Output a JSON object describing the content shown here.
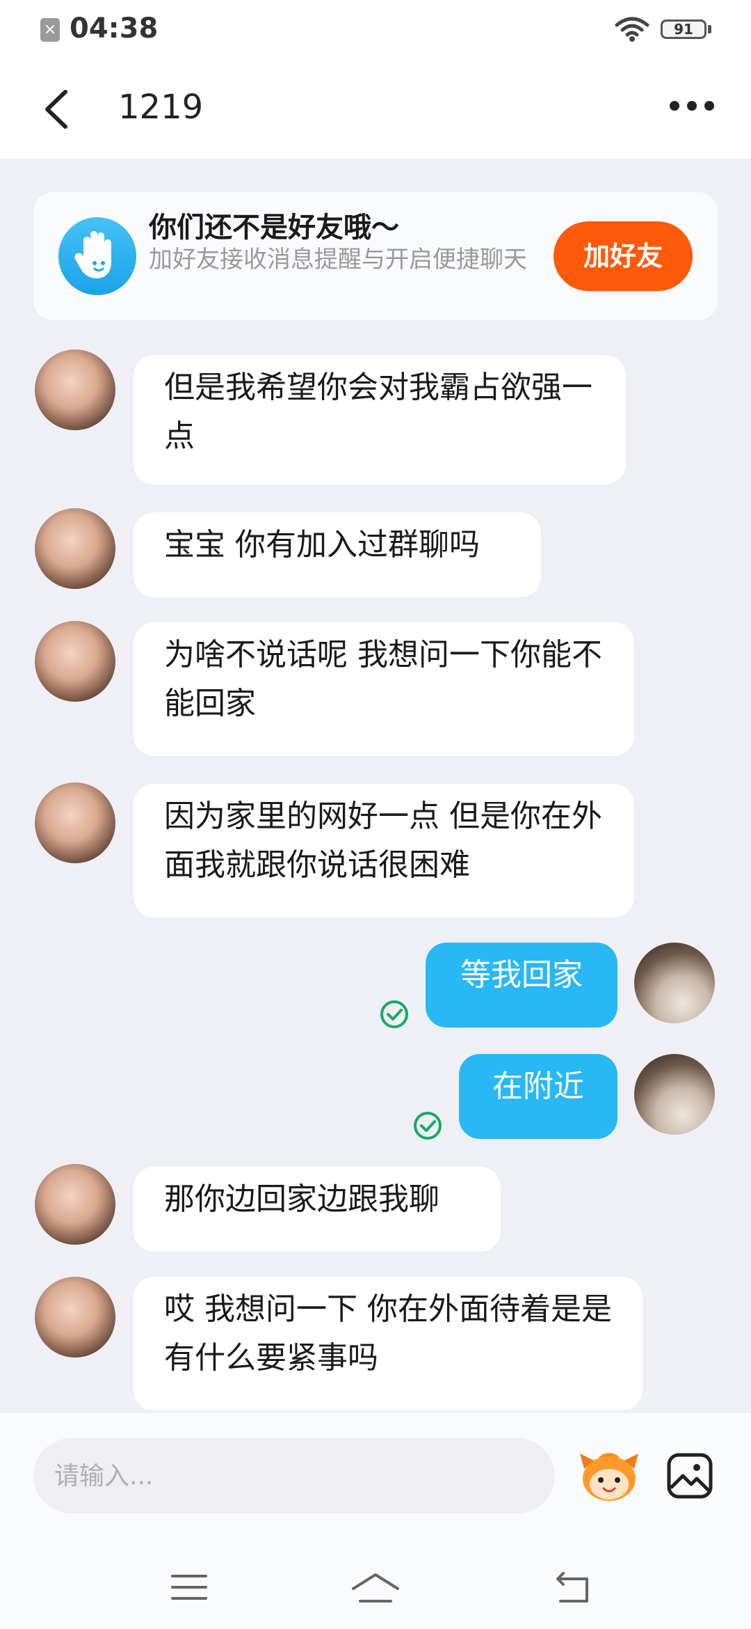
{
  "status": {
    "time": "04:38",
    "battery": "91"
  },
  "header": {
    "title": "1219"
  },
  "banner": {
    "title": "你们还不是好友哦～",
    "description": "加好友接收消息提醒与开启便捷聊天",
    "button_label": "加好友"
  },
  "messages": [
    {
      "side": "in",
      "text": "但是我希望你会对我霸占欲强一点"
    },
    {
      "side": "in",
      "text": "宝宝 你有加入过群聊吗"
    },
    {
      "side": "in",
      "text": "为啥不说话呢 我想问一下你能不能回家"
    },
    {
      "side": "in",
      "text": "因为家里的网好一点 但是你在外面我就跟你说话很困难"
    },
    {
      "side": "out",
      "text": "等我回家",
      "status": "read"
    },
    {
      "side": "out",
      "text": "在附近",
      "status": "read"
    },
    {
      "side": "in",
      "text": "那你边回家边跟我聊"
    },
    {
      "side": "in",
      "text": "哎 我想问一下 你在外面待着是是有什么要紧事吗"
    }
  ],
  "input": {
    "placeholder": "请输入..."
  },
  "colors": {
    "accent_blue": "#28b8f6",
    "add_button": "#ff5a0a",
    "read_check": "#1aa865"
  },
  "icons": {
    "back": "chevron-left-icon",
    "more": "more-dots-icon",
    "banner": "hand-wave-icon",
    "emoji": "emoji-face-icon",
    "image": "image-icon",
    "nav_menu": "menu-icon",
    "nav_home": "home-icon",
    "nav_back": "back-arrow-icon"
  }
}
